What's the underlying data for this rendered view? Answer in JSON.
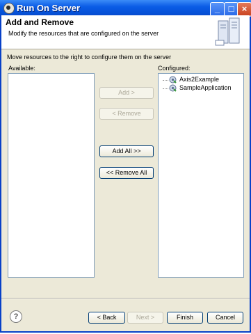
{
  "window": {
    "title": "Run On Server"
  },
  "banner": {
    "title": "Add and Remove",
    "description": "Modify the resources that are configured on the server"
  },
  "instruction": "Move resources to the right to configure them on the server",
  "available": {
    "label": "Available:",
    "items": []
  },
  "configured": {
    "label": "Configured:",
    "items": [
      {
        "label": "Axis2Example",
        "icon": "project-icon"
      },
      {
        "label": "SampleApplication",
        "icon": "project-icon"
      }
    ]
  },
  "move_buttons": {
    "add": "Add >",
    "remove": "< Remove",
    "add_all": "Add All >>",
    "remove_all": "<< Remove All"
  },
  "footer": {
    "back": "< Back",
    "next": "Next >",
    "finish": "Finish",
    "cancel": "Cancel"
  },
  "colors": {
    "titlebar": "#0a5ce6",
    "dialog_bg": "#ece9d8"
  }
}
